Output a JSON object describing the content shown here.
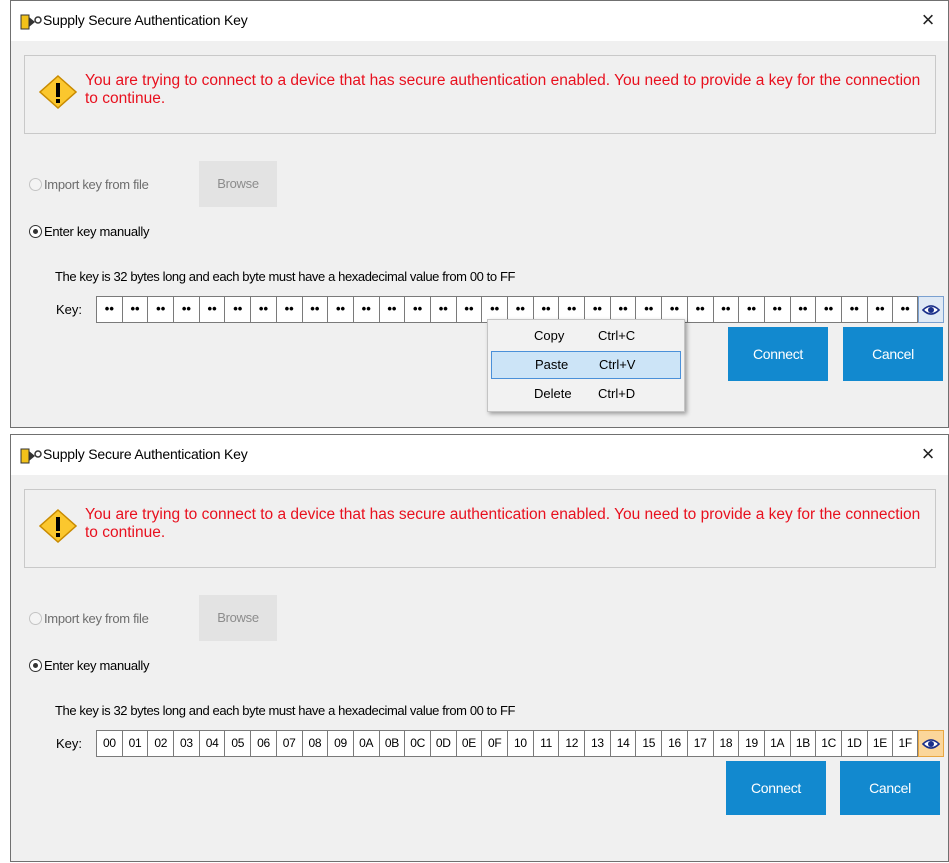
{
  "dialogs": [
    {
      "title": "Supply Secure Authentication Key",
      "close_glyph": "×",
      "warning": "You are trying to connect to a device that has secure authentication enabled. You need to provide a key for the connection to continue.",
      "import_label": "Import key from file",
      "browse_label": "Browse",
      "manual_label": "Enter key manually",
      "hint": "The key is 32 bytes long and each byte must have a hexadecimal value from 00 to FF",
      "key_label": "Key:",
      "key_visible": false,
      "key_bytes": [
        "••",
        "••",
        "••",
        "••",
        "••",
        "••",
        "••",
        "••",
        "••",
        "••",
        "••",
        "••",
        "••",
        "••",
        "••",
        "••",
        "••",
        "••",
        "••",
        "••",
        "••",
        "••",
        "••",
        "••",
        "••",
        "••",
        "••",
        "••",
        "••",
        "••",
        "••",
        "••"
      ],
      "connect_label": "Connect",
      "cancel_label": "Cancel",
      "context_menu": [
        {
          "label": "Copy",
          "shortcut": "Ctrl+C",
          "highlighted": false
        },
        {
          "label": "Paste",
          "shortcut": "Ctrl+V",
          "highlighted": true
        },
        {
          "label": "Delete",
          "shortcut": "Ctrl+D",
          "highlighted": false
        }
      ]
    },
    {
      "title": "Supply Secure Authentication Key",
      "close_glyph": "×",
      "warning": "You are trying to connect to a device that has secure authentication enabled. You need to provide a key for the connection to continue.",
      "import_label": "Import key from file",
      "browse_label": "Browse",
      "manual_label": "Enter key manually",
      "hint": "The key is 32 bytes long and each byte must have a hexadecimal value from 00 to FF",
      "key_label": "Key:",
      "key_visible": true,
      "key_bytes": [
        "00",
        "01",
        "02",
        "03",
        "04",
        "05",
        "06",
        "07",
        "08",
        "09",
        "0A",
        "0B",
        "0C",
        "0D",
        "0E",
        "0F",
        "10",
        "11",
        "12",
        "13",
        "14",
        "15",
        "16",
        "17",
        "18",
        "19",
        "1A",
        "1B",
        "1C",
        "1D",
        "1E",
        "1F"
      ],
      "connect_label": "Connect",
      "cancel_label": "Cancel"
    }
  ],
  "colors": {
    "warning_text": "#e8101e",
    "button_blue": "#1289cf",
    "menu_highlight": "#cce4f7",
    "eye_active": "#fbd69a"
  },
  "icons": {
    "title_icon": "key-icon",
    "warning_icon": "warning-icon",
    "reveal_icon": "eye-icon"
  }
}
